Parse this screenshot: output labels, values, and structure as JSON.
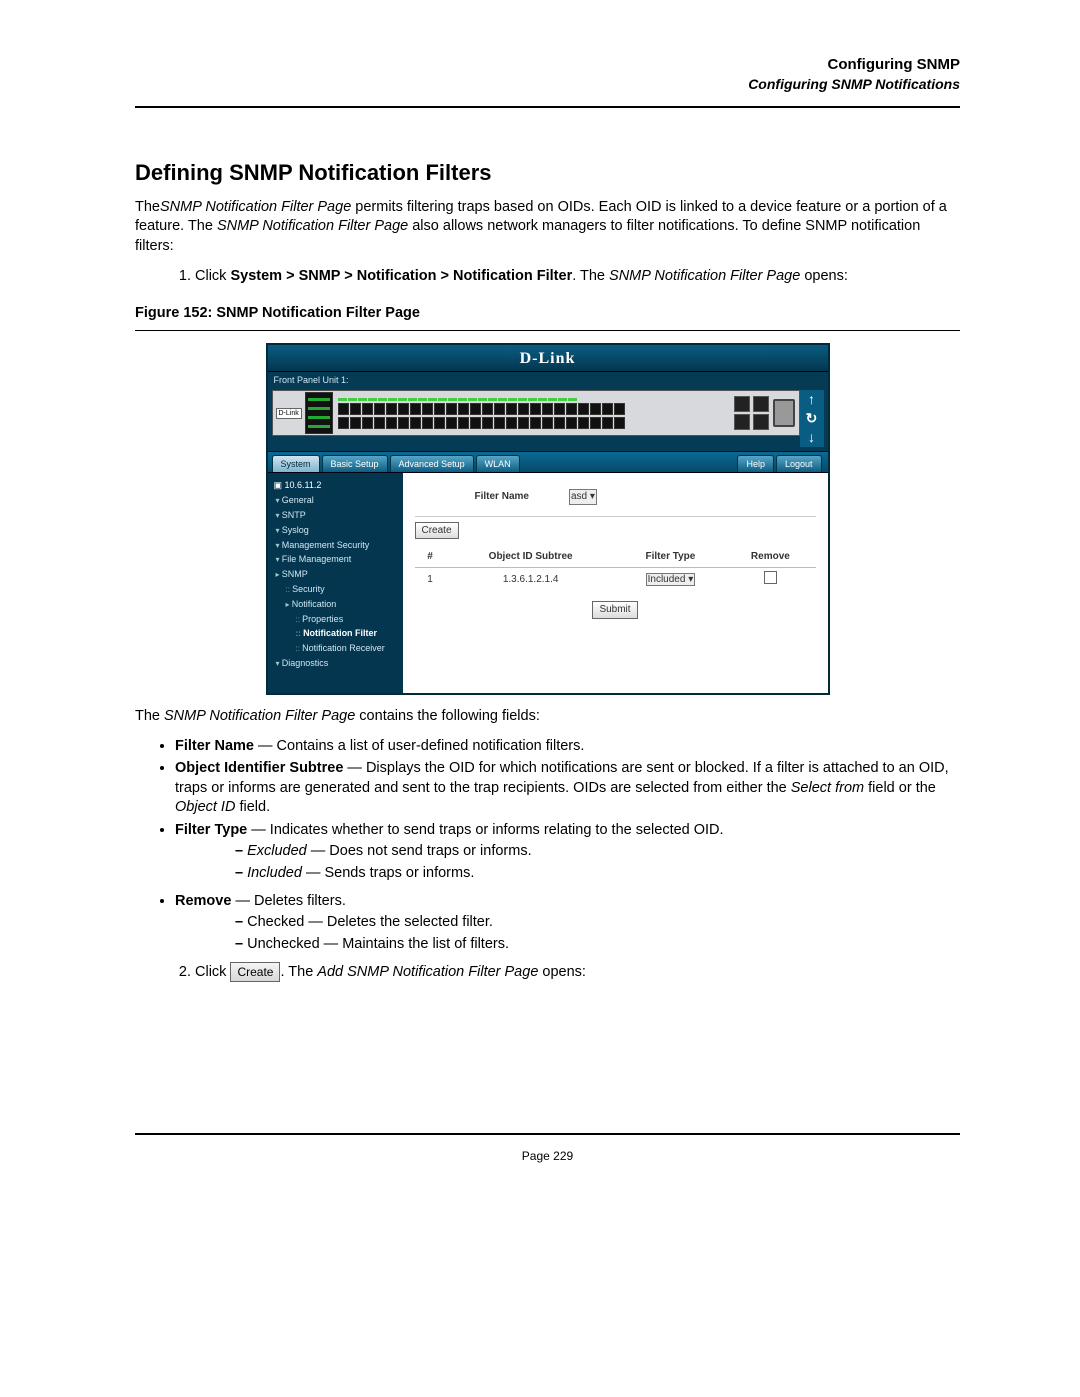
{
  "header": {
    "title": "Configuring SNMP",
    "subtitle": "Configuring SNMP Notifications"
  },
  "h1": "Defining SNMP Notification Filters",
  "intro": {
    "pre": "The",
    "page_em": "SNMP Notification Filter Page",
    "mid1": " permits filtering traps based on OIDs. Each OID is linked to a device feature or a portion of a feature. The ",
    "mid2": " also allows network managers to filter notifications. To define SNMP notification filters:"
  },
  "step1": {
    "lead": "Click ",
    "bold": "System > SNMP > Notification > Notification Filter",
    "after": ". The ",
    "em": "SNMP Notification Filter Page",
    "tail": " opens:"
  },
  "figcaption": "Figure 152: SNMP Notification Filter Page",
  "screenshot": {
    "brand": "D-Link",
    "front_panel_label": "Front Panel Unit 1:",
    "device_label": "D-Link",
    "arrows": {
      "up": "↑",
      "refresh": "↻",
      "down": "↓"
    },
    "tabs": {
      "system": "System",
      "basic": "Basic Setup",
      "advanced": "Advanced Setup",
      "wlan": "WLAN",
      "help": "Help",
      "logout": "Logout"
    },
    "sidebar": {
      "root": "10.6.11.2",
      "general": "General",
      "sntp": "SNTP",
      "syslog": "Syslog",
      "mgmt": "Management Security",
      "file": "File Management",
      "snmp": "SNMP",
      "security": "Security",
      "notification": "Notification",
      "properties": "Properties",
      "nf": "Notification Filter",
      "nr": "Notification Receiver",
      "diag": "Diagnostics"
    },
    "content": {
      "filter_name_label": "Filter Name",
      "filter_name_value": "asd",
      "create": "Create",
      "table": {
        "h_num": "#",
        "h_oid": "Object ID Subtree",
        "h_type": "Filter Type",
        "h_remove": "Remove",
        "r1_num": "1",
        "r1_oid": "1.3.6.1.2.1.4",
        "r1_type": "Included"
      },
      "submit": "Submit"
    }
  },
  "after_fig": {
    "pre": "The ",
    "em": "SNMP Notification Filter Page",
    "tail": " contains the following fields:"
  },
  "bullets": {
    "b1": {
      "bold": "Filter Name",
      "txt": " — Contains a list of user-defined notification filters."
    },
    "b2": {
      "bold": "Object Identifier Subtree",
      "txt": " — Displays the OID for which notifications are sent or blocked. If a filter is attached to an OID, traps or informs are generated and sent to the trap recipients. OIDs are selected from either the ",
      "em1": "Select from",
      "mid": " field or the ",
      "em2": "Object ID",
      "tail": " field."
    },
    "b3": {
      "bold": "Filter Type",
      "txt": " — Indicates whether to send traps or informs relating to the selected OID."
    },
    "b3a": {
      "em": "Excluded",
      "txt": " — Does not send traps or informs."
    },
    "b3b": {
      "em": "Included",
      "txt": " — Sends traps or informs."
    },
    "b4": {
      "bold": "Remove",
      "txt": " — Deletes filters."
    },
    "b4a": "Checked — Deletes the selected filter.",
    "b4b": "Unchecked — Maintains the list of filters."
  },
  "step2": {
    "lead": "Click ",
    "btn": "Create",
    "after": ". The ",
    "em": "Add SNMP Notification Filter Page",
    "tail": " opens:"
  },
  "footer": "Page 229"
}
